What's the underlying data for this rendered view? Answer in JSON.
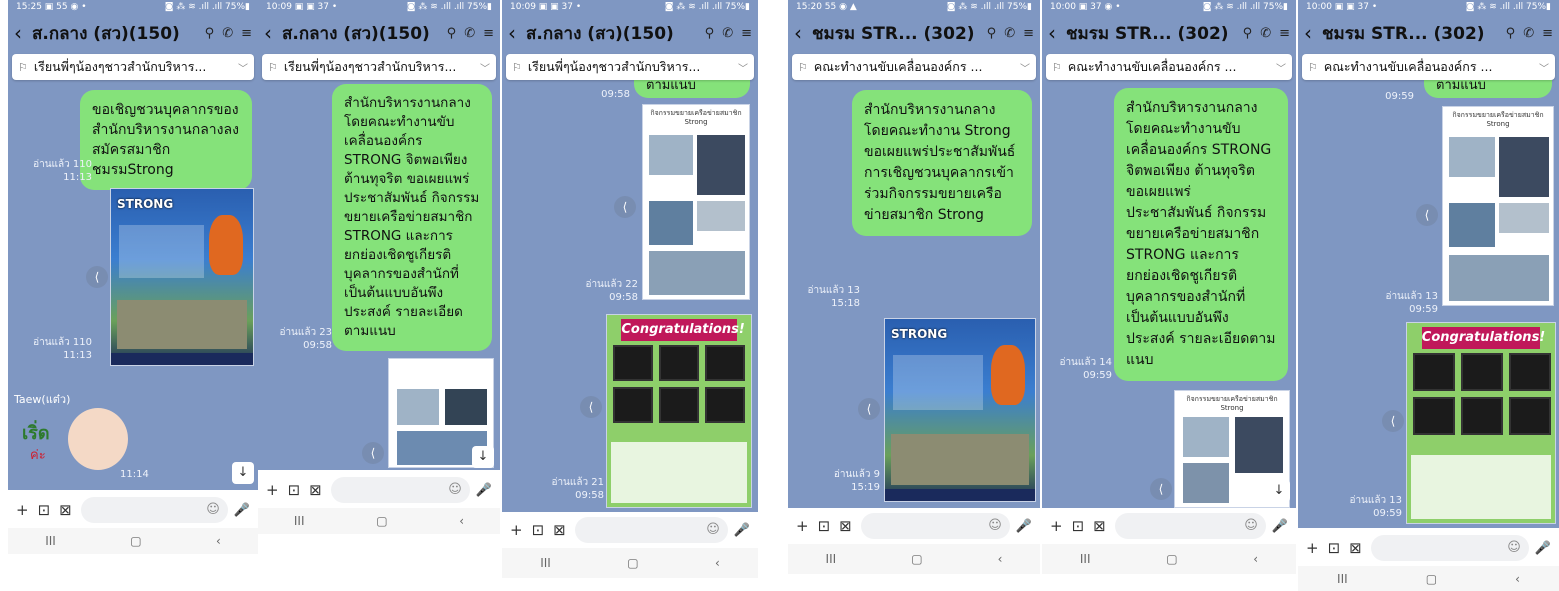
{
  "common": {
    "input_icons": {
      "plus": "+",
      "camera": "⊡",
      "gallery": "⊠",
      "emoji": "☺",
      "mic": "🎤"
    },
    "nav": {
      "recents": "III",
      "home": "▢",
      "back": "‹"
    },
    "header_icons": {
      "search": "⚲",
      "call": "✆",
      "menu": "≡"
    },
    "share_icon": "⟨",
    "back_icon": "‹",
    "pin_icon": "⚐",
    "pin_chevron": "﹀",
    "chat_bg": "#7f97c2",
    "bubble_color": "#85e27a"
  },
  "panel1": {
    "status": {
      "time": "15:25 ▣ 55 ◉ •",
      "right": "◙ ⁂ ≋ .ıll .ıll 75%▮"
    },
    "title": "ส.กลาง (สว)(150)",
    "pinned": "เรียนพี่ๆน้องๆชาวสำนักบริหาร...",
    "bubble": "ขอเชิญชวนบุคลากรของสำนักบริหารงานกลางลงสมัครสมาชิกชมรมStrong",
    "read1": {
      "label": "อ่านแล้ว 110",
      "time": "11:13"
    },
    "poster_title": "STRONG",
    "read2": {
      "label": "อ่านแล้ว 110",
      "time": "11:13"
    },
    "sender": "Taew(แต๋ว)",
    "sticker_text": "เริ่ด",
    "sticker_sub": "ค่ะ",
    "sticker_time": "11:14",
    "down": "↓"
  },
  "panel2": {
    "status": {
      "time": "10:09 ▣ ▣ 37 •",
      "right": "◙ ⁂ ≋ .ıll .ıll 75%▮"
    },
    "title": "ส.กลาง (สว)(150)",
    "pinned": "เรียนพี่ๆน้องๆชาวสำนักบริหาร...",
    "bubble": "สำนักบริหารงานกลาง โดยคณะทำงานขับเคลื่อนองค์กร STRONG จิตพอเพียง ต้านทุจริต ขอเผยแพร่ประชาสัมพันธ์ กิจกรรมขยายเครือข่ายสมาชิก STRONG และการยกย่องเชิดชูเกียรติบุคลากรของสำนักที่เป็นต้นแบบอันพึงประสงค์ รายละเอียดตามแนบ",
    "read1": {
      "label": "อ่านแล้ว 23",
      "time": "09:58"
    },
    "down": "↓"
  },
  "panel3": {
    "status": {
      "time": "10:09 ▣ ▣ 37 •",
      "right": "◙ ⁂ ≋ .ıll .ıll 75%▮"
    },
    "title": "ส.กลาง (สว)(150)",
    "pinned": "เรียนพี่ๆน้องๆชาวสำนักบริหาร...",
    "top_time": "09:58",
    "top_snip": "ตามแนบ",
    "doc_title": "กิจกรรมขยายเครือข่ายสมาชิก Strong",
    "read1": {
      "label": "อ่านแล้ว 22",
      "time": "09:58"
    },
    "congrats": "Congratulations!",
    "read2": {
      "label": "อ่านแล้ว 21",
      "time": "09:58"
    }
  },
  "panel4": {
    "status": {
      "time": "15:20 55 ◉ ▲",
      "right": "◙ ⁂ ≋ .ıll .ıll 75%▮"
    },
    "title": "ชมรม STR... (302)",
    "pinned": "คณะทำงานขับเคลื่อนองค์กร ...",
    "bubble": "สำนักบริหารงานกลาง โดยคณะทำงาน Strong ขอเผยแพร่ประชาสัมพันธ์ การเชิญชวนบุคลากรเข้าร่วมกิจกรรมขยายเครือข่ายสมาชิก Strong",
    "read1": {
      "label": "อ่านแล้ว 13",
      "time": "15:18"
    },
    "poster_title": "STRONG",
    "read2": {
      "label": "อ่านแล้ว 9",
      "time": "15:19"
    }
  },
  "panel5": {
    "status": {
      "time": "10:00 ▣ 37 ◉ •",
      "right": "◙ ⁂ ≋ .ıll .ıll 75%▮"
    },
    "title": "ชมรม STR... (302)",
    "pinned": "คณะทำงานขับเคลื่อนองค์กร ...",
    "bubble": "สำนักบริหารงานกลาง โดยคณะทำงานขับเคลื่อนองค์กร STRONG จิตพอเพียง ต้านทุจริต ขอเผยแพร่ประชาสัมพันธ์ กิจกรรมขยายเครือข่ายสมาชิก STRONG และการยกย่องเชิดชูเกียรติบุคลากรของสำนักที่เป็นต้นแบบอันพึงประสงค์ รายละเอียดตามแนบ",
    "read1": {
      "label": "อ่านแล้ว 14",
      "time": "09:59"
    },
    "doc_title": "กิจกรรมขยายเครือข่ายสมาชิก Strong",
    "down": "↓"
  },
  "panel6": {
    "status": {
      "time": "10:00 ▣ ▣ 37 •",
      "right": "◙ ⁂ ≋ .ıll .ıll 75%▮"
    },
    "title": "ชมรม STR... (302)",
    "pinned": "คณะทำงานขับเคลื่อนองค์กร ...",
    "top_time": "09:59",
    "top_snip": "ตามแนบ",
    "doc_title": "กิจกรรมขยายเครือข่ายสมาชิก Strong",
    "read1": {
      "label": "อ่านแล้ว 13",
      "time": "09:59"
    },
    "congrats": "Congratulations!",
    "read2": {
      "label": "อ่านแล้ว 13",
      "time": "09:59"
    }
  }
}
